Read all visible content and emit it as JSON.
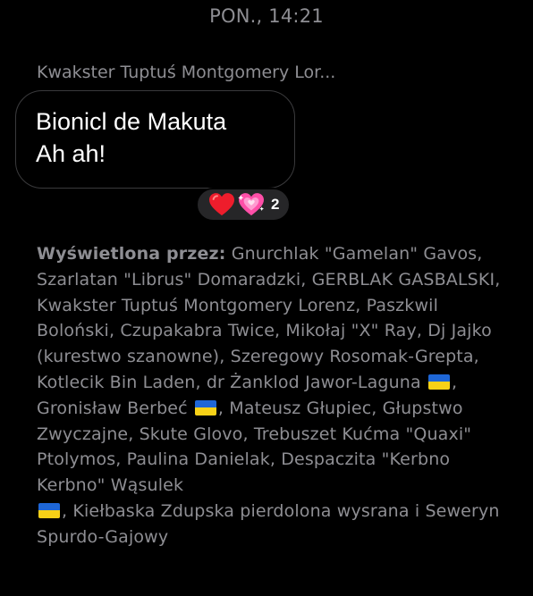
{
  "header": {
    "timestamp": "PON., 14:21"
  },
  "message": {
    "sender": "Kwakster Tuptuś Montgomery Lor...",
    "lines": [
      "Bionicl de Makuta",
      "Ah ah!"
    ],
    "reactions": {
      "emojis": [
        "red-heart-icon",
        "sparkling-heart-icon"
      ],
      "count": "2"
    }
  },
  "seen_by": {
    "label": "Wyświetlona przez:",
    "parts": [
      " Gnurchlak \"Gamelan\" Gavos, Szarlatan \"Librus\" Domaradzki, GERBLAK GASBALSKI, Kwakster Tuptuś Montgomery Lorenz, Paszkwil Boloński, Czupakabra Twice, Mikołaj \"X\" Ray, Dj Jajko (kurestwo szanowne), Szeregowy Rosomak-Grepta, Kotlecik Bin Laden, dr Żanklod Jawor-Laguna ",
      ", Gronisław Berbeć ",
      ", Mateusz Głupiec, Głupstwo Zwyczajne, Skute Glovo, Trebuszet Kućma \"Quaxi\" Ptolymos, Paulina Danielak, Despaczita \"Kerbno Kerbno\" Wąsulek ",
      ", Kiełbaska Zdupska pierdolona wysrana i Seweryn Spurdo-Gajowy"
    ],
    "flag_icon": "ukraine-flag-icon"
  },
  "colors": {
    "background": "#000000",
    "secondary_text": "#8e8e93",
    "bubble_border": "#3a3a3c",
    "reaction_pill": "#262628",
    "flag_blue": "#1e66d6",
    "flag_yellow": "#f7d117"
  }
}
